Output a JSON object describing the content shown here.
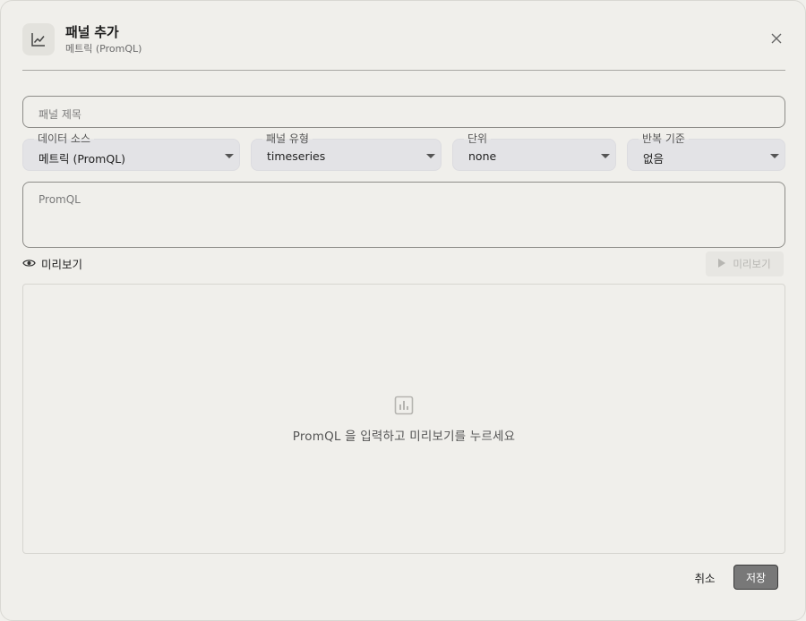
{
  "header": {
    "title": "패널 추가",
    "subtitle": "메트릭 (PromQL)",
    "icon": "line-chart-icon"
  },
  "form": {
    "panel_title_placeholder": "패널 제목",
    "datasource": {
      "label": "데이터 소스",
      "value": "메트릭 (PromQL)"
    },
    "panel_type": {
      "label": "패널 유형",
      "value": "timeseries"
    },
    "unit": {
      "label": "단위",
      "value": "none"
    },
    "repeat": {
      "label": "반복 기준",
      "value": "없음"
    },
    "promql_placeholder": "PromQL"
  },
  "preview": {
    "section_label": "미리보기",
    "button_label": "미리보기",
    "empty_message": "PromQL 을 입력하고 미리보기를 누르세요"
  },
  "footer": {
    "cancel_label": "취소",
    "save_label": "저장"
  },
  "colors": {
    "background": "#f0efeb",
    "select_bg": "#e3e3e6",
    "save_bg": "#787878"
  }
}
